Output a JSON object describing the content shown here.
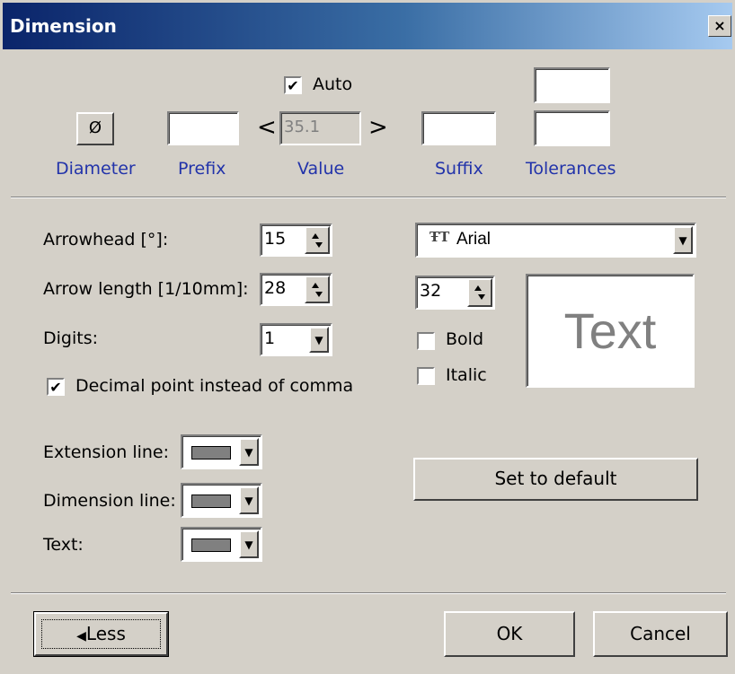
{
  "window": {
    "title": "Dimension",
    "close_glyph": "×"
  },
  "top": {
    "auto_label": "Auto",
    "auto_checked": true,
    "diameter_button": "Ø",
    "diameter_label": "Diameter",
    "prefix_label": "Prefix",
    "prefix_value": "",
    "value_open": "<",
    "value_close": ">",
    "value_value": "35.1",
    "value_label": "Value",
    "suffix_label": "Suffix",
    "suffix_value": "",
    "tolerance_upper": "",
    "tolerance_lower": "",
    "tolerances_label": "Tolerances"
  },
  "settings": {
    "arrowhead_label": "Arrowhead [°]:",
    "arrowhead_value": "15",
    "arrow_length_label": "Arrow length [1/10mm]:",
    "arrow_length_value": "28",
    "digits_label": "Digits:",
    "digits_value": "1",
    "decimal_point_label": "Decimal point instead of comma",
    "decimal_point_checked": true,
    "extension_line_label": "Extension line:",
    "dimension_line_label": "Dimension line:",
    "text_label": "Text:",
    "line_color": "#808080"
  },
  "font": {
    "font_icon": "truetype-font-icon",
    "font_icon_glyph": "ŦT",
    "font_name": "Arial",
    "size_value": "32",
    "bold_label": "Bold",
    "bold_checked": false,
    "italic_label": "Italic",
    "italic_checked": false,
    "preview_text": "Text",
    "preview_color": "#808080",
    "default_button": "Set to default"
  },
  "footer": {
    "less_glyph": "◀",
    "less_button": "Less",
    "ok_button": "OK",
    "cancel_button": "Cancel"
  }
}
